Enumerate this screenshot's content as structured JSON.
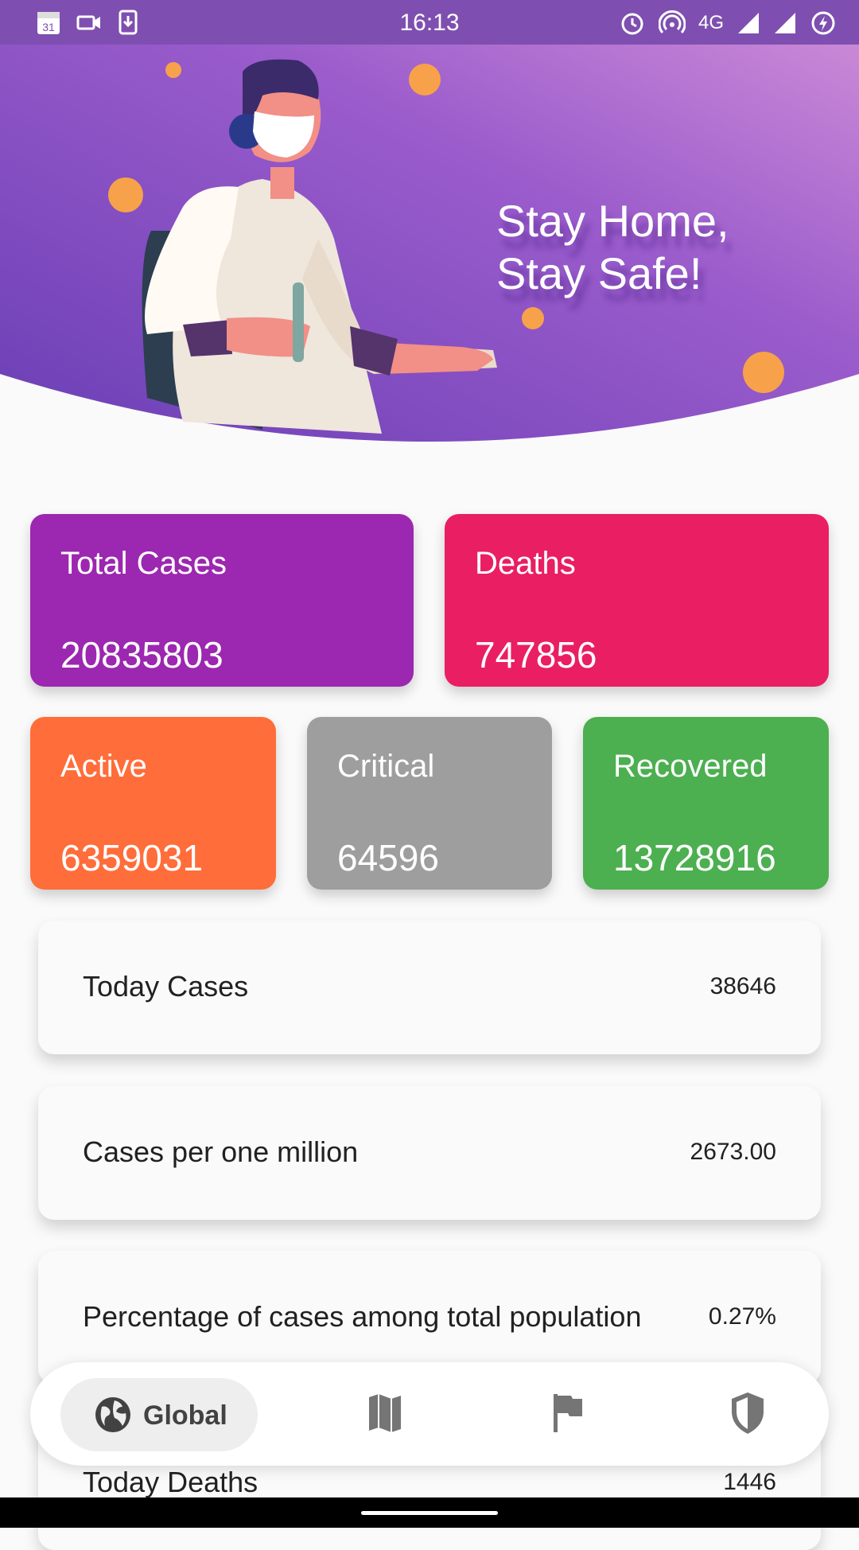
{
  "status_bar": {
    "time": "16:13",
    "network": "4G"
  },
  "hero": {
    "line1": "Stay Home,",
    "line2": "Stay Safe!"
  },
  "cards": {
    "total_cases": {
      "label": "Total Cases",
      "value": "20835803",
      "color": "#9c27b0"
    },
    "deaths": {
      "label": "Deaths",
      "value": "747856",
      "color": "#e91e63"
    },
    "active": {
      "label": "Active",
      "value": "6359031",
      "color": "#ff6d3a"
    },
    "critical": {
      "label": "Critical",
      "value": "64596",
      "color": "#9e9e9e"
    },
    "recovered": {
      "label": "Recovered",
      "value": "13728916",
      "color": "#4caf50"
    }
  },
  "stats": [
    {
      "label": "Today Cases",
      "value": "38646"
    },
    {
      "label": "Cases per one million",
      "value": "2673.00"
    },
    {
      "label": "Percentage of cases among total population",
      "value": "0.27%"
    },
    {
      "label": "Today Deaths",
      "value": "1446"
    }
  ],
  "bottom_nav": {
    "items": [
      {
        "label": "Global",
        "icon": "globe-icon",
        "selected": true
      },
      {
        "label": "",
        "icon": "map-icon",
        "selected": false
      },
      {
        "label": "",
        "icon": "flag-icon",
        "selected": false
      },
      {
        "label": "",
        "icon": "shield-icon",
        "selected": false
      }
    ]
  }
}
